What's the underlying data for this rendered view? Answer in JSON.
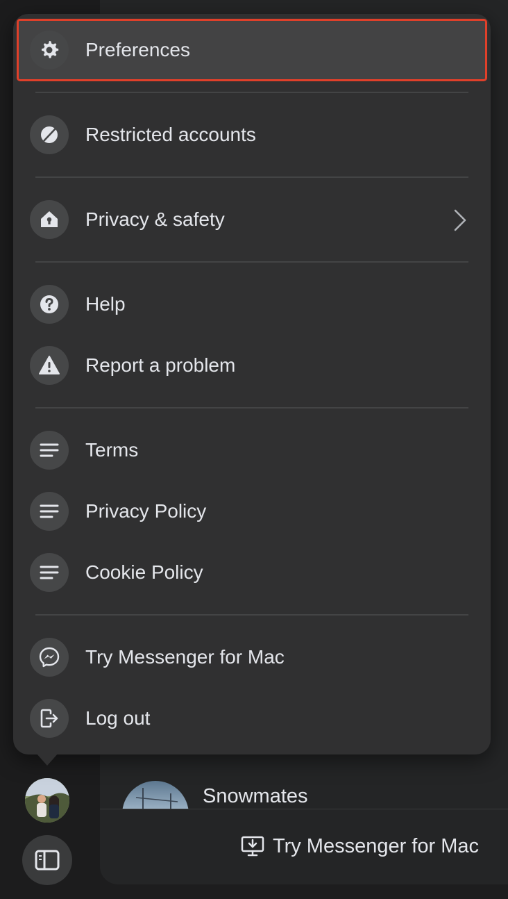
{
  "menu": {
    "items": [
      {
        "label": "Preferences",
        "icon": "gear-icon",
        "highlighted": true
      },
      {
        "label": "Restricted accounts",
        "icon": "restricted-icon"
      },
      {
        "label": "Privacy & safety",
        "icon": "house-lock-icon",
        "has_submenu": true
      },
      {
        "label": "Help",
        "icon": "question-icon"
      },
      {
        "label": "Report a problem",
        "icon": "warning-icon"
      },
      {
        "label": "Terms",
        "icon": "lines-icon"
      },
      {
        "label": "Privacy Policy",
        "icon": "lines-icon"
      },
      {
        "label": "Cookie Policy",
        "icon": "lines-icon"
      },
      {
        "label": "Try Messenger for Mac",
        "icon": "messenger-icon"
      },
      {
        "label": "Log out",
        "icon": "logout-icon"
      }
    ]
  },
  "chat": {
    "name": "Snowmates"
  },
  "bottom_bar": {
    "try_mac_label": "Try Messenger for Mac"
  },
  "colors": {
    "highlight_outline": "#e0402a",
    "menu_bg": "#303031"
  }
}
